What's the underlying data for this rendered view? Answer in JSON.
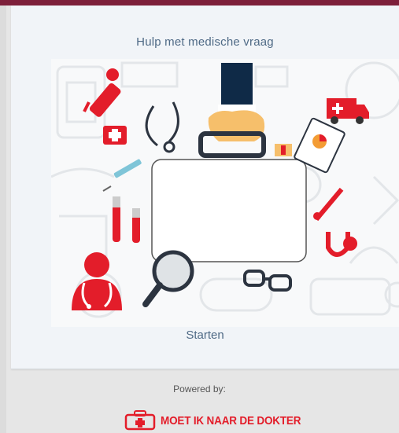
{
  "header": {
    "accent_color": "#7d1f3a"
  },
  "card": {
    "title": "Hulp met medische vraag",
    "start_label": "Starten",
    "illustration": "medical-kit-illustration"
  },
  "footer": {
    "powered_label": "Powered by:",
    "brand_name": "MOET IK NAAR DE DOKTER",
    "brand_color": "#e31d2a"
  }
}
